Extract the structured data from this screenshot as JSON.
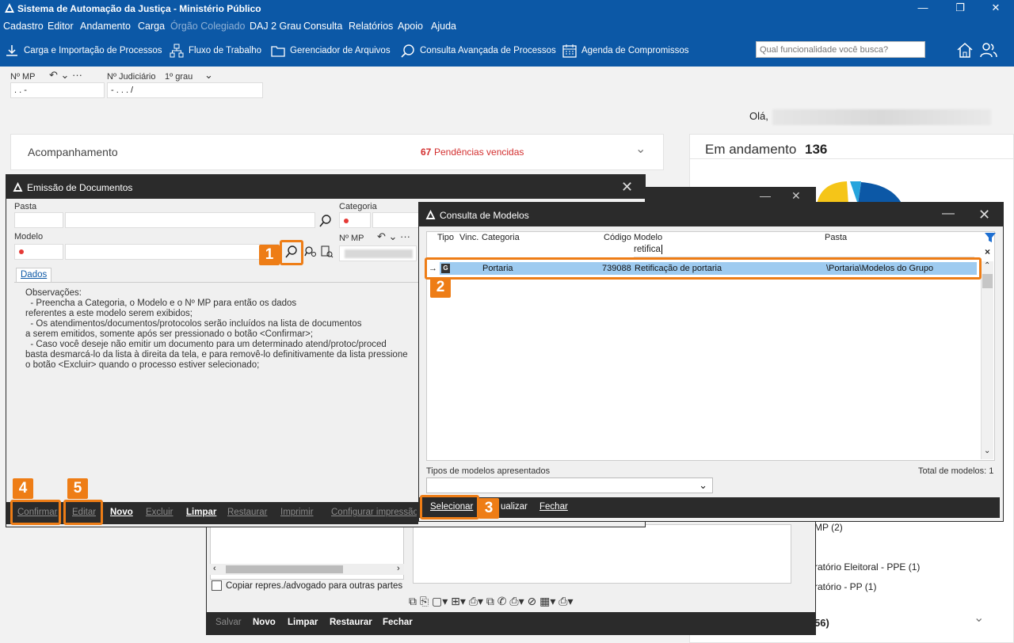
{
  "window": {
    "title": "Sistema de Automação da Justiça - Ministério Público",
    "controls": {
      "minimize": "—",
      "restore": "❐",
      "close": "✕"
    }
  },
  "menu": [
    {
      "label": "Cadastro",
      "disabled": false
    },
    {
      "label": "Editor",
      "disabled": false
    },
    {
      "label": "Andamento",
      "disabled": false
    },
    {
      "label": "Carga",
      "disabled": false
    },
    {
      "label": "Órgão Colegiado",
      "disabled": true
    },
    {
      "label": "DAJ 2 Grau",
      "disabled": false
    },
    {
      "label": "Consulta",
      "disabled": false
    },
    {
      "label": "Relatórios",
      "disabled": false
    },
    {
      "label": "Apoio",
      "disabled": false
    },
    {
      "label": "Ajuda",
      "disabled": false
    }
  ],
  "toolbar": {
    "carga": "Carga e Importação de Processos",
    "fluxo": "Fluxo de Trabalho",
    "arquivos": "Gerenciador de Arquivos",
    "consulta": "Consulta Avançada de Processos",
    "agenda": "Agenda de Compromissos",
    "search_placeholder": "Qual funcionalidade você busca?"
  },
  "main": {
    "nmp_label": "Nº MP",
    "nmp_value": ".  .      -",
    "njud_label": "Nº Judiciário",
    "grau_label": "1º grau",
    "njud_value": "-  .  .  .   /",
    "greeting": "Olá,",
    "acompanhamento": "Acompanhamento",
    "pendencias_count": "67",
    "pendencias_label": "Pendências vencidas",
    "andamento_label": "Em andamento",
    "andamento_count": "136",
    "list_item_1": "MP (2)",
    "list_item_2": "ratório Eleitoral - PPE (1)",
    "list_item_3": "ratório - PP (1)",
    "list_item_4": "56)",
    "copiar_label": "Copiar repres./advogado para outras partes",
    "bg_footer": {
      "salvar": "Salvar",
      "novo": "Novo",
      "limpar": "Limpar",
      "restaurar": "Restaurar",
      "fechar": "Fechar"
    }
  },
  "emissao": {
    "title": "Emissão de Documentos",
    "pasta_label": "Pasta",
    "categoria_label": "Categoria",
    "modelo_label": "Modelo",
    "nmp_label": "Nº MP",
    "tab_dados": "Dados",
    "observacoes": "Observações:\n  - Preencha a Categoria, o Modelo e o Nº MP para então os dados\nreferentes a este modelo serem exibidos;\n  - Os atendimentos/documentos/protocolos serão incluídos na lista de documentos\na serem emitidos, somente após ser pressionado o botão <Confirmar>;\n  - Caso você deseje não emitir um documento para um determinado atend/protoc/proced\nbasta desmarcá-lo da lista à direita da tela, e para removê-lo definitivamente da lista pressione\no botão <Excluir> quando o processo estiver selecionado;",
    "footer": {
      "confirmar": "Confirmar",
      "editar": "Editar",
      "novo": "Novo",
      "excluir": "Excluir",
      "limpar": "Limpar",
      "restaurar": "Restaurar",
      "imprimir": "Imprimir",
      "configurar": "Configurar impressão"
    }
  },
  "consulta": {
    "title": "Consulta de Modelos",
    "columns": {
      "tipo": "Tipo",
      "vinc": "Vinc.",
      "categoria": "Categoria",
      "codigo": "Código",
      "modelo": "Modelo",
      "pasta": "Pasta"
    },
    "filter_modelo": "retifica",
    "row": {
      "tipo": "G",
      "categoria": "Portaria",
      "codigo": "739088",
      "modelo": "Retificação de portaria",
      "pasta": "\\Portaria\\Modelos do Grupo"
    },
    "tipos_label": "Tipos de modelos apresentados",
    "total_label": "Total de modelos: 1",
    "footer": {
      "selecionar": "Selecionar",
      "visualizar": "ualizar",
      "fechar": "Fechar"
    }
  },
  "callouts": [
    "1",
    "2",
    "3",
    "4",
    "5"
  ]
}
